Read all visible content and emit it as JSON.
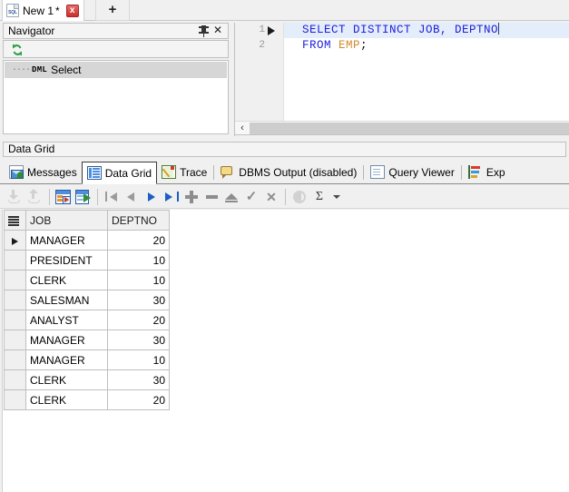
{
  "window": {
    "tab": {
      "icon": "sql-file-icon",
      "title": "New 1",
      "dirty": "*",
      "close_label": "x",
      "new_tab_label": "+"
    }
  },
  "navigator": {
    "title": "Navigator",
    "pin_icon": "pin-icon",
    "close_icon": "close-icon",
    "refresh_icon": "refresh-icon",
    "tree": {
      "dots": "····",
      "type": "DML",
      "label": "Select"
    }
  },
  "editor": {
    "lines": [
      {
        "number": "1",
        "has_run_marker": true,
        "active": true,
        "tokens": [
          {
            "text": "SELECT DISTINCT JOB, DEPTNO",
            "type": "keyword"
          }
        ],
        "caret": true
      },
      {
        "number": "2",
        "has_run_marker": false,
        "active": false,
        "tokens": [
          {
            "text": "FROM ",
            "type": "keyword"
          },
          {
            "text": "EMP",
            "type": "identifier"
          },
          {
            "text": ";",
            "type": "plain"
          }
        ],
        "caret": false
      }
    ],
    "full_text": "SELECT DISTINCT JOB, DEPTNO\nFROM EMP;",
    "scroll_left_label": "‹"
  },
  "results": {
    "caption": "Data Grid",
    "tabs": [
      {
        "label": "Messages",
        "icon": "messages-icon",
        "selected": false
      },
      {
        "label": "Data Grid",
        "icon": "data-grid-icon",
        "selected": true
      },
      {
        "label": "Trace",
        "icon": "trace-icon",
        "selected": false
      },
      {
        "label": "DBMS Output (disabled)",
        "icon": "dbms-output-icon",
        "selected": false
      },
      {
        "label": "Query Viewer",
        "icon": "query-viewer-icon",
        "selected": false
      },
      {
        "label": "Exp",
        "icon": "explain-plan-icon",
        "selected": false
      }
    ]
  },
  "grid_toolbar": {
    "buttons": [
      {
        "name": "import-data-button",
        "icon": "import-icon",
        "disabled": true
      },
      {
        "name": "export-data-button",
        "icon": "export-icon",
        "disabled": true
      },
      {
        "name": "edit-grid-button",
        "icon": "grid-edit-icon",
        "disabled": false
      },
      {
        "name": "grid-to-sql-button",
        "icon": "grid-go-icon",
        "disabled": false
      },
      {
        "name": "first-record-button",
        "icon": "first-record-icon",
        "disabled": false
      },
      {
        "name": "previous-record-button",
        "icon": "previous-record-icon",
        "disabled": true
      },
      {
        "name": "next-record-button",
        "icon": "next-record-icon",
        "disabled": false
      },
      {
        "name": "last-record-button",
        "icon": "last-record-icon",
        "disabled": false
      },
      {
        "name": "insert-record-button",
        "icon": "plus-icon",
        "disabled": true
      },
      {
        "name": "delete-record-button",
        "icon": "minus-icon",
        "disabled": true
      },
      {
        "name": "post-edit-button",
        "icon": "up-triangle-icon",
        "disabled": true
      },
      {
        "name": "commit-button",
        "icon": "check-icon",
        "disabled": true
      },
      {
        "name": "cancel-button",
        "icon": "x-icon",
        "disabled": true
      },
      {
        "name": "toggle-blob-button",
        "icon": "half-circle-icon",
        "disabled": true
      },
      {
        "name": "aggregate-button",
        "icon": "sigma-icon",
        "disabled": false
      },
      {
        "name": "aggregate-dropdown-button",
        "icon": "chevron-down-icon",
        "disabled": false
      }
    ],
    "sigma_glyph": "Σ"
  },
  "grid": {
    "indicator_header_icon": "record-selector-icon",
    "columns": [
      "JOB",
      "DEPTNO"
    ],
    "rows": [
      {
        "current": true,
        "JOB": "MANAGER",
        "DEPTNO": "20"
      },
      {
        "current": false,
        "JOB": "PRESIDENT",
        "DEPTNO": "10"
      },
      {
        "current": false,
        "JOB": "CLERK",
        "DEPTNO": "10"
      },
      {
        "current": false,
        "JOB": "SALESMAN",
        "DEPTNO": "30"
      },
      {
        "current": false,
        "JOB": "ANALYST",
        "DEPTNO": "20"
      },
      {
        "current": false,
        "JOB": "MANAGER",
        "DEPTNO": "30"
      },
      {
        "current": false,
        "JOB": "MANAGER",
        "DEPTNO": "10"
      },
      {
        "current": false,
        "JOB": "CLERK",
        "DEPTNO": "30"
      },
      {
        "current": false,
        "JOB": "CLERK",
        "DEPTNO": "20"
      }
    ]
  },
  "colors": {
    "keyword": "#2020dd",
    "identifier": "#d08b2a",
    "active_line": "#e4edfa",
    "panel": "#f0f0f0",
    "tab_close_red": "#c9302c",
    "refresh_green": "#2f9e44"
  }
}
